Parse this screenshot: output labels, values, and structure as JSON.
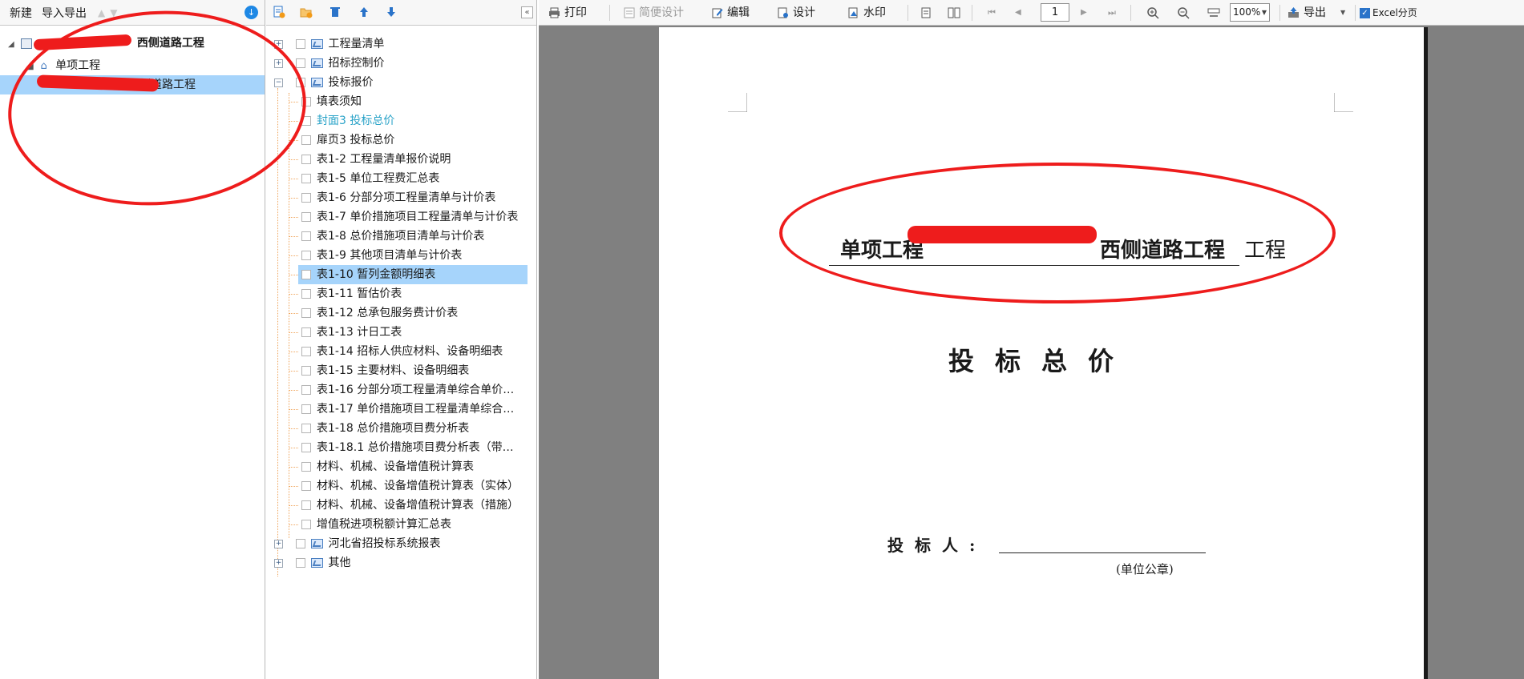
{
  "left_toolbar": {
    "new_label": "新建",
    "import_export_label": "导入导出"
  },
  "left_tree": {
    "root_label": "西侧道路工程",
    "child_label": "单项工程",
    "grandchild_label": "西侧道路工程"
  },
  "report_tree": {
    "groups": [
      {
        "label": "工程量清单"
      },
      {
        "label": "招标控制价"
      },
      {
        "label": "投标报价"
      }
    ],
    "items": [
      "填表须知",
      "封面3 投标总价",
      "扉页3 投标总价",
      "表1-2 工程量清单报价说明",
      "表1-5 单位工程费汇总表",
      "表1-6 分部分项工程量清单与计价表",
      "表1-7 单价措施项目工程量清单与计价表",
      "表1-8 总价措施项目清单与计价表",
      "表1-9 其他项目清单与计价表",
      "表1-10 暂列金额明细表",
      "表1-11 暂估价表",
      "表1-12 总承包服务费计价表",
      "表1-13 计日工表",
      "表1-14 招标人供应材料、设备明细表",
      "表1-15 主要材料、设备明细表",
      "表1-16 分部分项工程量清单综合单价…",
      "表1-17 单价措施项目工程量清单综合…",
      "表1-18 总价措施项目费分析表",
      "表1-18.1 总价措施项目费分析表（带…",
      "材料、机械、设备增值税计算表",
      "材料、机械、设备增值税计算表（实体）",
      "材料、机械、设备增值税计算表（措施）",
      "增值税进项税额计算汇总表"
    ],
    "bottom_groups": [
      {
        "label": "河北省招投标系统报表"
      },
      {
        "label": "其他"
      }
    ]
  },
  "viewer_toolbar": {
    "print": "打印",
    "simple_design": "简便设计",
    "edit": "编辑",
    "design": "设计",
    "watermark": "水印",
    "page": "1",
    "zoom": "100%",
    "export": "导出",
    "excel_paging": "Excel分页"
  },
  "document": {
    "title_prefix": "单项工程",
    "title_project": "西侧道路工程",
    "title_suffix": "工程",
    "heading": "投标总价",
    "bidder_label": "投标人:",
    "seal_label": "(单位公章)"
  },
  "colors": {
    "selected_row": "#a6d4fb",
    "link_text": "#2aa3c8",
    "annotation_red": "#ee1c1c",
    "viewer_bg": "#808080"
  }
}
